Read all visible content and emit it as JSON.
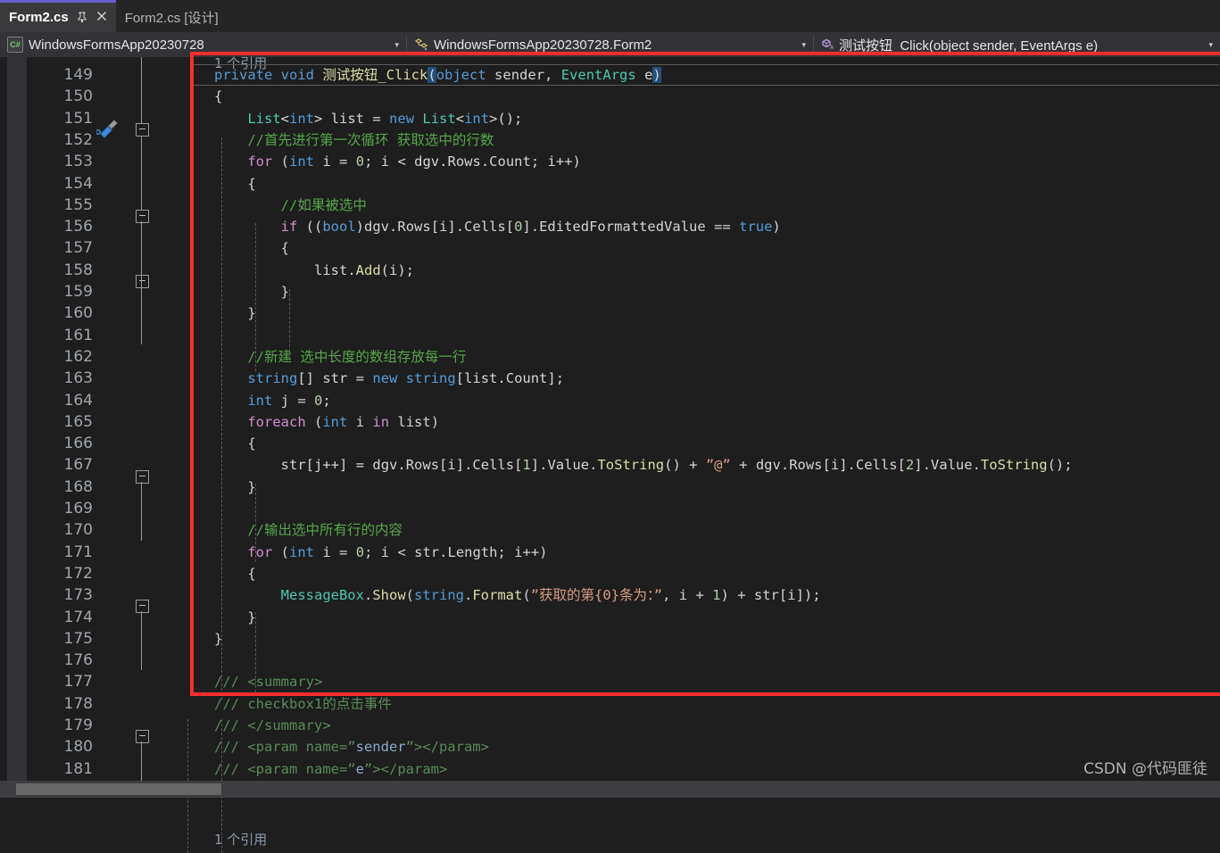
{
  "window": {
    "accent_color": "#6b5fcf",
    "editor_bg": "#1e1e1e",
    "annotation_color": "#fb2e2e"
  },
  "tabs": [
    {
      "label": "Form2.cs",
      "active": true,
      "pin_icon": "pin-icon",
      "close_icon": "close-icon"
    },
    {
      "label": "Form2.cs [设计]",
      "active": false
    }
  ],
  "breadcrumb": {
    "project": {
      "icon": "csharp-file-icon",
      "label": "WindowsFormsApp20230728",
      "dropdown": "▾"
    },
    "type": {
      "icon": "class-icon",
      "label": "WindowsFormsApp20230728.Form2",
      "dropdown": "▾"
    },
    "member": {
      "icon": "method-icon",
      "label": "测试按钮_Click(object sender, EventArgs e)",
      "dropdown": "▾"
    }
  },
  "editor": {
    "language": "csharp",
    "first_visible_line": 149,
    "current_line": 149,
    "glyph_icon": "quick-actions-screwdriver-icon",
    "codelens_clipped_top": "1 个引用",
    "codelens_bottom": "1 个引用",
    "lines": [
      {
        "num": 149,
        "text": "    private void 测试按钮_Click(object sender, EventArgs e)"
      },
      {
        "num": 150,
        "text": "    {"
      },
      {
        "num": 151,
        "text": "        List<int> list = new List<int>();"
      },
      {
        "num": 152,
        "text": "        //首先进行第一次循环 获取选中的行数"
      },
      {
        "num": 153,
        "text": "        for (int i = 0; i < dgv.Rows.Count; i++)"
      },
      {
        "num": 154,
        "text": "        {"
      },
      {
        "num": 155,
        "text": "            //如果被选中"
      },
      {
        "num": 156,
        "text": "            if ((bool)dgv.Rows[i].Cells[0].EditedFormattedValue == true)"
      },
      {
        "num": 157,
        "text": "            {"
      },
      {
        "num": 158,
        "text": "                list.Add(i);"
      },
      {
        "num": 159,
        "text": "            }"
      },
      {
        "num": 160,
        "text": "        }"
      },
      {
        "num": 161,
        "text": ""
      },
      {
        "num": 162,
        "text": "        //新建 选中长度的数组存放每一行"
      },
      {
        "num": 163,
        "text": "        string[] str = new string[list.Count];"
      },
      {
        "num": 164,
        "text": "        int j = 0;"
      },
      {
        "num": 165,
        "text": "        foreach (int i in list)"
      },
      {
        "num": 166,
        "text": "        {"
      },
      {
        "num": 167,
        "text": "            str[j++] = dgv.Rows[i].Cells[1].Value.ToString() + \"@\" + dgv.Rows[i].Cells[2].Value.ToString();"
      },
      {
        "num": 168,
        "text": "        }"
      },
      {
        "num": 169,
        "text": ""
      },
      {
        "num": 170,
        "text": "        //输出选中所有行的内容"
      },
      {
        "num": 171,
        "text": "        for (int i = 0; i < str.Length; i++)"
      },
      {
        "num": 172,
        "text": "        {"
      },
      {
        "num": 173,
        "text": "            MessageBox.Show(string.Format(\"获取的第{0}条为：\", i + 1) + str[i]);"
      },
      {
        "num": 174,
        "text": "        }"
      },
      {
        "num": 175,
        "text": "    }"
      },
      {
        "num": 176,
        "text": ""
      },
      {
        "num": 177,
        "text": "    /// <summary>"
      },
      {
        "num": 178,
        "text": "    /// checkbox1的点击事件"
      },
      {
        "num": 179,
        "text": "    /// </summary>"
      },
      {
        "num": 180,
        "text": "    /// <param name=\"sender\"></param>"
      },
      {
        "num": 181,
        "text": "    /// <param name=\"e\"></param>"
      }
    ]
  },
  "watermark": {
    "text": "CSDN @代码匪徒"
  }
}
